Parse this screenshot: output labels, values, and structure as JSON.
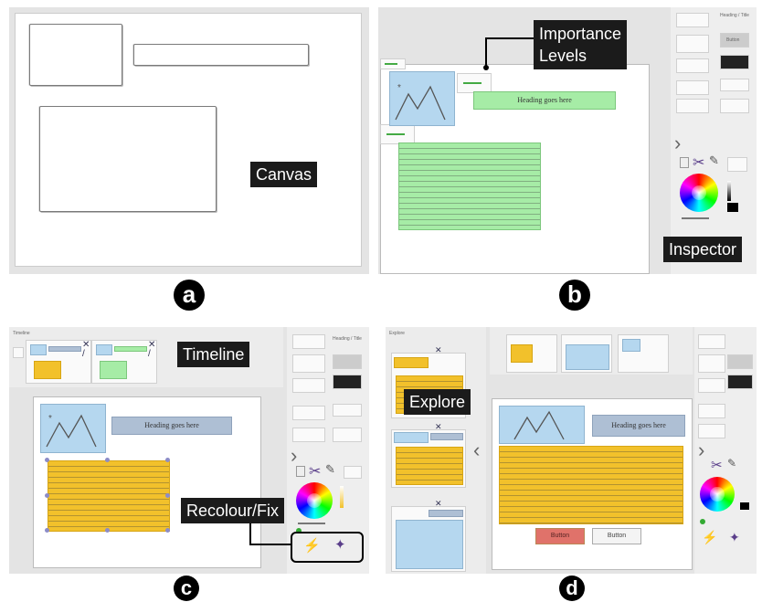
{
  "panels": {
    "a": {
      "letter": "a",
      "label": "Canvas"
    },
    "b": {
      "letter": "b",
      "label_importance": "Importance\nLevels",
      "label_inspector": "Inspector",
      "heading": "Heading goes here"
    },
    "c": {
      "letter": "c",
      "label_timeline": "Timeline",
      "label_recolour": "Recolour/Fix",
      "heading": "Heading goes here"
    },
    "d": {
      "letter": "d",
      "label_explore": "Explore",
      "heading": "Heading goes here",
      "button1": "Button",
      "button2": "Button"
    }
  },
  "inspector": {
    "title": "Heading / Title",
    "button": "Button"
  },
  "colors": {
    "blue": "#b5d7ef",
    "green": "#a6eca6",
    "yellow": "#f2c12b",
    "red": "#e0726a"
  },
  "icons": [
    "scissors-icon",
    "trash-icon",
    "eyedropper-icon",
    "color-wheel-icon",
    "wand-icon",
    "wrench-icon",
    "chevron-right-icon",
    "chevron-left-icon",
    "close-icon",
    "edit-icon",
    "lock-icon",
    "image-icon"
  ]
}
